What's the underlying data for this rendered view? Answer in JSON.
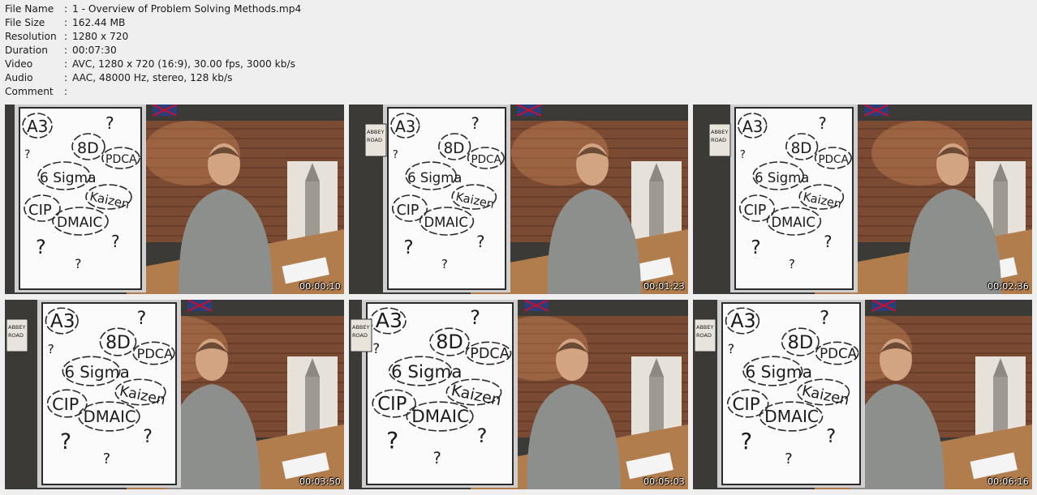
{
  "info": [
    {
      "label": "File Name",
      "value": "1 - Overview of Problem Solving Methods.mp4"
    },
    {
      "label": "File Size",
      "value": "162.44 MB"
    },
    {
      "label": "Resolution",
      "value": "1280 x 720"
    },
    {
      "label": "Duration",
      "value": "00:07:30"
    },
    {
      "label": "Video",
      "value": "AVC, 1280 x 720 (16:9), 30.00 fps, 3000 kb/s"
    },
    {
      "label": "Audio",
      "value": "AAC, 48000 Hz, stereo, 128 kb/s"
    },
    {
      "label": "Comment",
      "value": ""
    }
  ],
  "colon": ":",
  "thumbnails": [
    {
      "timestamp": "00:00:10"
    },
    {
      "timestamp": "00:01:23"
    },
    {
      "timestamp": "00:02:36"
    },
    {
      "timestamp": "00:03:50"
    },
    {
      "timestamp": "00:05:03"
    },
    {
      "timestamp": "00:06:16"
    }
  ],
  "flipchart": {
    "words": [
      "A3",
      "8D",
      "PDCA",
      "6 Sigma",
      "CIP",
      "Kaizen",
      "DMAIC"
    ],
    "question_mark": "?"
  },
  "sign": {
    "line1": "ABBEY",
    "line2": "ROAD"
  }
}
